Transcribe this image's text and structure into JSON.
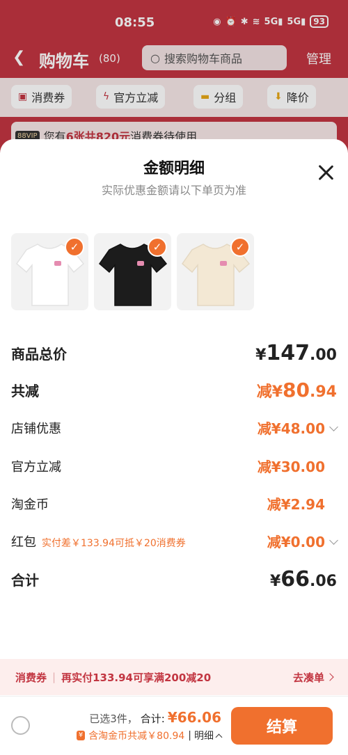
{
  "status_bar": {
    "time": "08:55",
    "network": "5G",
    "battery": "93"
  },
  "header": {
    "back_icon": "back-arrow-icon",
    "title": "购物车",
    "count": "(80)",
    "search_placeholder": "搜索购物车商品",
    "manage_label": "管理"
  },
  "filters": [
    {
      "label": "消费券",
      "icon": "coupon-icon"
    },
    {
      "label": "官方立减",
      "icon": "lightning-icon"
    },
    {
      "label": "分组",
      "icon": "folder-icon"
    },
    {
      "label": "降价",
      "icon": "down-arrow-icon"
    }
  ],
  "promo_banner": {
    "badge": "88VIP",
    "text_pre": "您有",
    "highlight": "6张共820元",
    "text_post": "消费券待使用"
  },
  "sheet": {
    "title": "金额明细",
    "subtitle": "实际优惠金额请以下单页为准",
    "thumbnails": [
      {
        "color": "white",
        "fill": "#ffffff",
        "checked": true
      },
      {
        "color": "black",
        "fill": "#1c1c1c",
        "checked": true
      },
      {
        "color": "beige",
        "fill": "#f3e8d4",
        "checked": true
      }
    ],
    "rows": {
      "total": {
        "label": "商品总价",
        "symbol": "¥",
        "int": "147",
        "dec": ".00"
      },
      "discount": {
        "label": "共减",
        "symbol": "减¥",
        "int": "80",
        "dec": ".94"
      },
      "store": {
        "label": "店铺优惠",
        "value": "减¥48.00"
      },
      "official": {
        "label": "官方立减",
        "value": "减¥30.00"
      },
      "coins": {
        "label": "淘金币",
        "value": "减¥2.94"
      },
      "redpacket": {
        "label": "红包",
        "note": "实付差￥133.94可抵￥20消费券",
        "value": "减¥0.00"
      },
      "sum": {
        "label": "合计",
        "symbol": "¥",
        "int": "66",
        "dec": ".06"
      }
    }
  },
  "coupon_bar": {
    "label": "消费券",
    "sep": "|",
    "text": "再实付133.94可享满200减20",
    "action": "去凑单"
  },
  "footer": {
    "selected": "已选3件，",
    "total_label": "合计:",
    "total_amount": "¥66.06",
    "coin_badge": "¥",
    "discount_text": "含淘金币共减￥80.94",
    "separator": "|",
    "detail_label": "明细",
    "checkout_label": "结算"
  },
  "colors": {
    "brand_red": "#c23541",
    "accent_orange": "#f0702e"
  }
}
